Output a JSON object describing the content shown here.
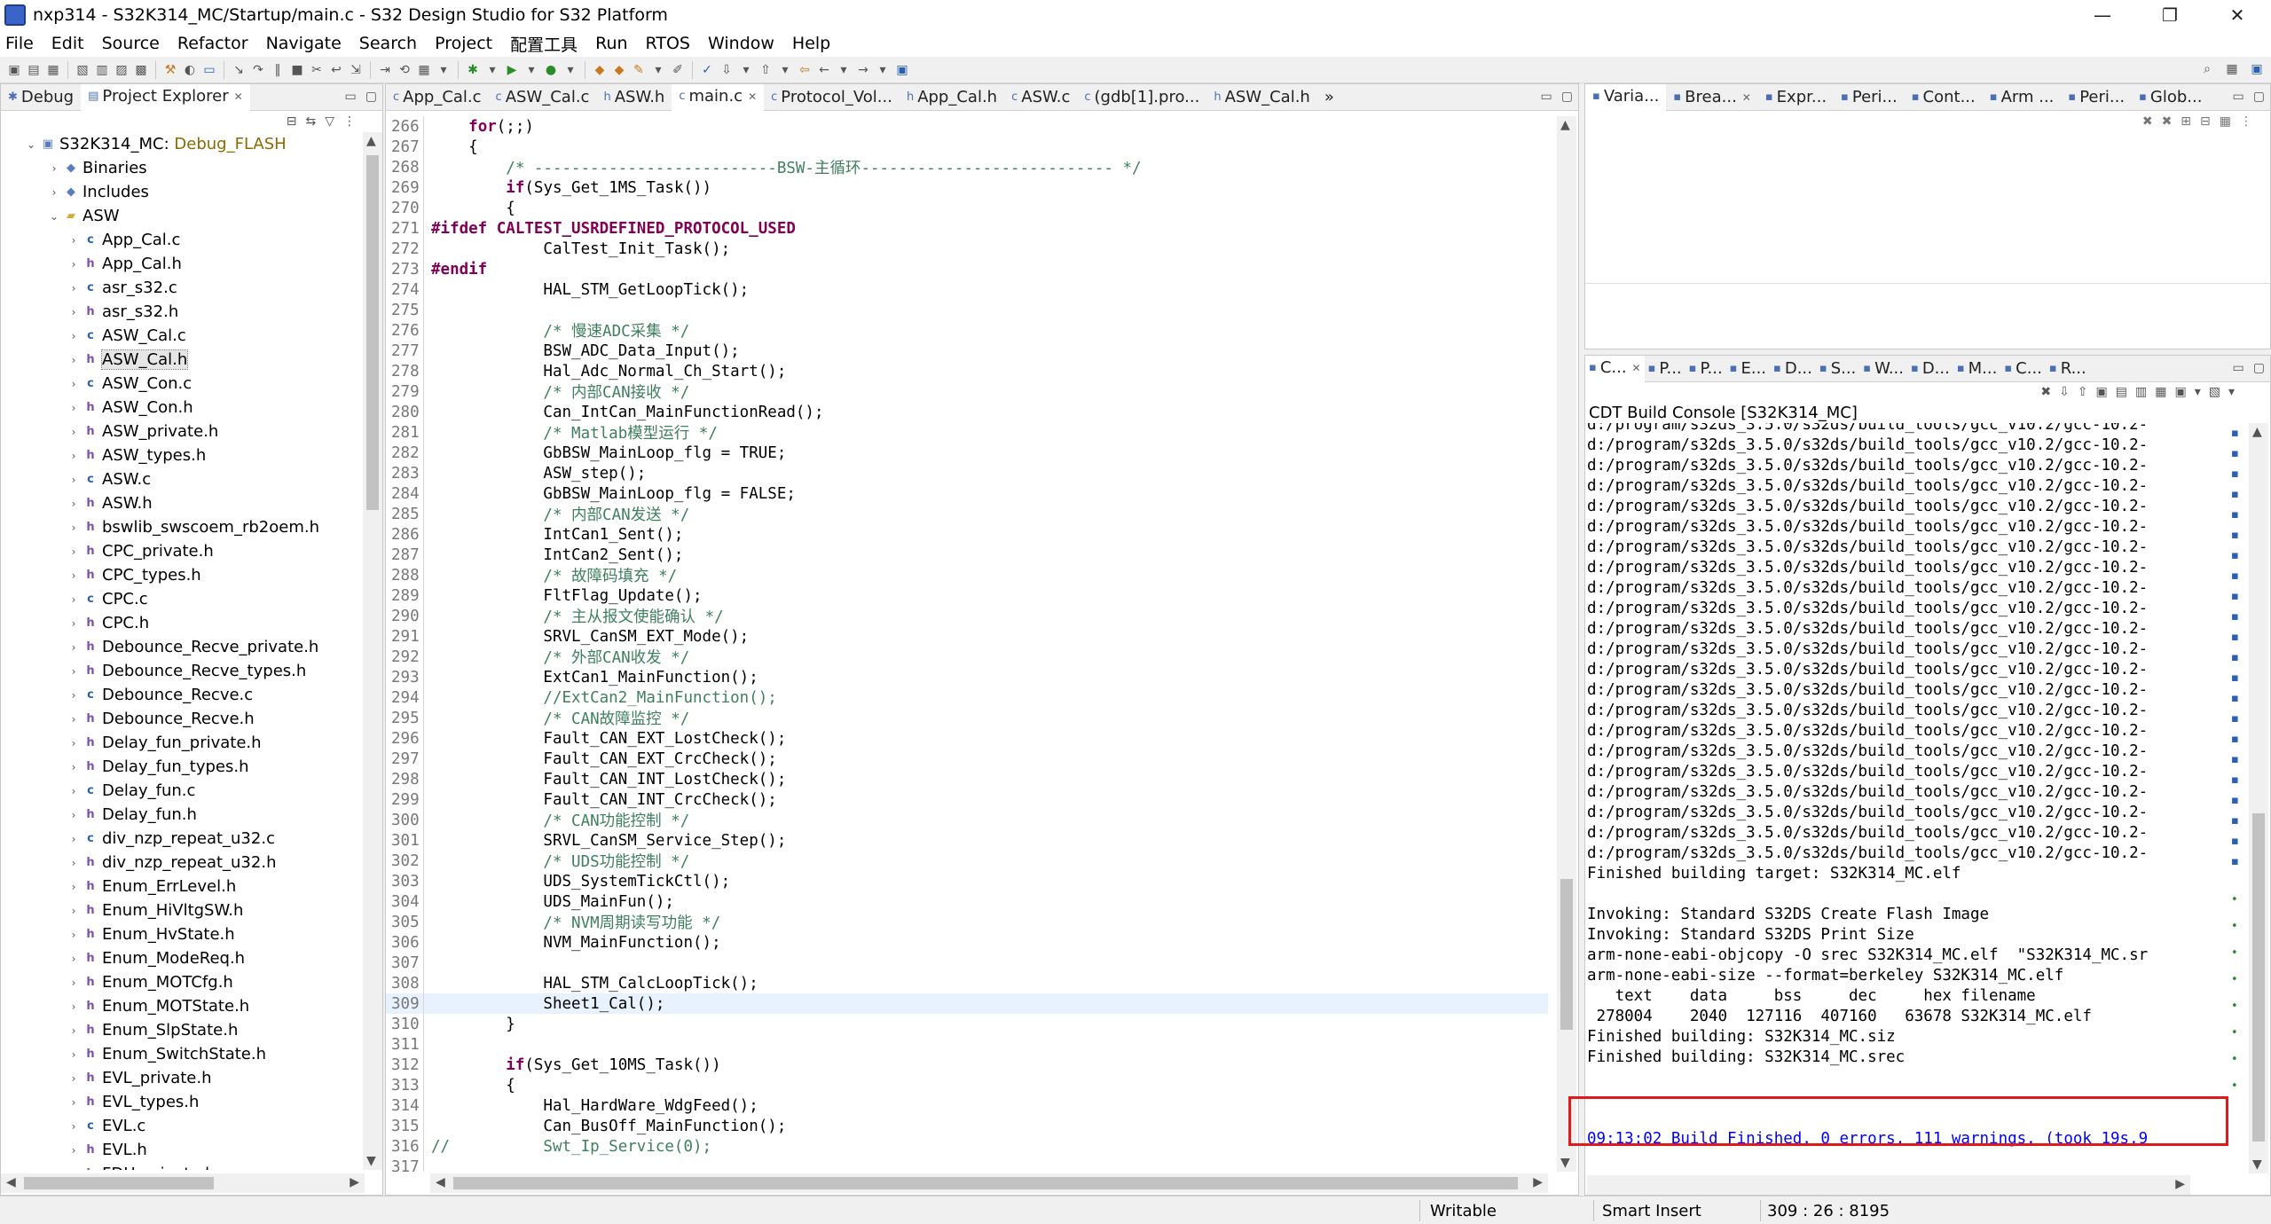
{
  "window": {
    "title": "nxp314 - S32K314_MC/Startup/main.c - S32 Design Studio for S32 Platform",
    "controls": [
      "—",
      "❐",
      "✕"
    ]
  },
  "menu": [
    "File",
    "Edit",
    "Source",
    "Refactor",
    "Navigate",
    "Search",
    "Project",
    "配置工具",
    "Run",
    "RTOS",
    "Window",
    "Help"
  ],
  "explorer": {
    "tabs": [
      {
        "icon": "debug-icon",
        "label": "Debug"
      },
      {
        "icon": "project-explorer-icon",
        "label": "Project Explorer"
      }
    ],
    "project": {
      "name": "S32K314_MC",
      "config": "Debug_FLASH"
    },
    "nodes": [
      {
        "label": "Binaries",
        "depth": 1,
        "expanded": false,
        "icon": "binaries-icon"
      },
      {
        "label": "Includes",
        "depth": 1,
        "expanded": false,
        "icon": "includes-icon"
      },
      {
        "label": "ASW",
        "depth": 1,
        "expanded": true,
        "icon": "folder-icon"
      }
    ],
    "files": [
      "App_Cal.c",
      "App_Cal.h",
      "asr_s32.c",
      "asr_s32.h",
      "ASW_Cal.c",
      "ASW_Cal.h",
      "ASW_Con.c",
      "ASW_Con.h",
      "ASW_private.h",
      "ASW_types.h",
      "ASW.c",
      "ASW.h",
      "bswlib_swscoem_rb2oem.h",
      "CPC_private.h",
      "CPC_types.h",
      "CPC.c",
      "CPC.h",
      "Debounce_Recve_private.h",
      "Debounce_Recve_types.h",
      "Debounce_Recve.c",
      "Debounce_Recve.h",
      "Delay_fun_private.h",
      "Delay_fun_types.h",
      "Delay_fun.c",
      "Delay_fun.h",
      "div_nzp_repeat_u32.c",
      "div_nzp_repeat_u32.h",
      "Enum_ErrLevel.h",
      "Enum_HiVltgSW.h",
      "Enum_HvState.h",
      "Enum_ModeReq.h",
      "Enum_MOTCfg.h",
      "Enum_MOTState.h",
      "Enum_SlpState.h",
      "Enum_SwitchState.h",
      "EVL_private.h",
      "EVL_types.h",
      "EVL.c",
      "EVL.h",
      "FDH_private.h"
    ],
    "selected": "ASW_Cal.h"
  },
  "editor": {
    "tabs": [
      "App_Cal.c",
      "ASW_Cal.c",
      "ASW.h",
      "main.c",
      "Protocol_Vol...",
      "App_Cal.h",
      "ASW.c",
      "(gdb[1].pro...",
      "ASW_Cal.h"
    ],
    "active_tab": "main.c",
    "overflow": "»",
    "current_line": 309,
    "lines": [
      {
        "n": "266",
        "t": "    for(;;)"
      },
      {
        "n": "267",
        "t": "    {"
      },
      {
        "n": "268",
        "t": "        /* --------------------------BSW-主循环--------------------------- */"
      },
      {
        "n": "269",
        "t": "        if(Sys_Get_1MS_Task())"
      },
      {
        "n": "270",
        "t": "        {"
      },
      {
        "n": "271",
        "t": "#ifdef CALTEST_USRDEFINED_PROTOCOL_USED"
      },
      {
        "n": "272",
        "t": "            CalTest_Init_Task();"
      },
      {
        "n": "273",
        "t": "#endif"
      },
      {
        "n": "274",
        "t": "            HAL_STM_GetLoopTick();"
      },
      {
        "n": "275",
        "t": ""
      },
      {
        "n": "276",
        "t": "            /* 慢速ADC采集 */"
      },
      {
        "n": "277",
        "t": "            BSW_ADC_Data_Input();"
      },
      {
        "n": "278",
        "t": "            Hal_Adc_Normal_Ch_Start();"
      },
      {
        "n": "279",
        "t": "            /* 内部CAN接收 */"
      },
      {
        "n": "280",
        "t": "            Can_IntCan_MainFunctionRead();"
      },
      {
        "n": "281",
        "t": "            /* Matlab模型运行 */"
      },
      {
        "n": "282",
        "t": "            GbBSW_MainLoop_flg = TRUE;"
      },
      {
        "n": "283",
        "t": "            ASW_step();"
      },
      {
        "n": "284",
        "t": "            GbBSW_MainLoop_flg = FALSE;"
      },
      {
        "n": "285",
        "t": "            /* 内部CAN发送 */"
      },
      {
        "n": "286",
        "t": "            IntCan1_Sent();"
      },
      {
        "n": "287",
        "t": "            IntCan2_Sent();"
      },
      {
        "n": "288",
        "t": "            /* 故障码填充 */"
      },
      {
        "n": "289",
        "t": "            FltFlag_Update();"
      },
      {
        "n": "290",
        "t": "            /* 主从报文使能确认 */"
      },
      {
        "n": "291",
        "t": "            SRVL_CanSM_EXT_Mode();"
      },
      {
        "n": "292",
        "t": "            /* 外部CAN收发 */"
      },
      {
        "n": "293",
        "t": "            ExtCan1_MainFunction();"
      },
      {
        "n": "294",
        "t": "            //ExtCan2_MainFunction();"
      },
      {
        "n": "295",
        "t": "            /* CAN故障监控 */"
      },
      {
        "n": "296",
        "t": "            Fault_CAN_EXT_LostCheck();"
      },
      {
        "n": "297",
        "t": "            Fault_CAN_EXT_CrcCheck();"
      },
      {
        "n": "298",
        "t": "            Fault_CAN_INT_LostCheck();"
      },
      {
        "n": "299",
        "t": "            Fault_CAN_INT_CrcCheck();"
      },
      {
        "n": "300",
        "t": "            /* CAN功能控制 */"
      },
      {
        "n": "301",
        "t": "            SRVL_CanSM_Service_Step();"
      },
      {
        "n": "302",
        "t": "            /* UDS功能控制 */"
      },
      {
        "n": "303",
        "t": "            UDS_SystemTickCtl();"
      },
      {
        "n": "304",
        "t": "            UDS_MainFun();"
      },
      {
        "n": "305",
        "t": "            /* NVM周期读写功能 */"
      },
      {
        "n": "306",
        "t": "            NVM_MainFunction();"
      },
      {
        "n": "307",
        "t": ""
      },
      {
        "n": "308",
        "t": "            HAL_STM_CalcLoopTick();"
      },
      {
        "n": "309",
        "t": "            Sheet1_Cal();"
      },
      {
        "n": "310",
        "t": "        }"
      },
      {
        "n": "311",
        "t": ""
      },
      {
        "n": "312",
        "t": "        if(Sys_Get_10MS_Task())"
      },
      {
        "n": "313",
        "t": "        {"
      },
      {
        "n": "314",
        "t": "            Hal_HardWare_WdgFeed();"
      },
      {
        "n": "315",
        "t": "            Can_BusOff_MainFunction();"
      },
      {
        "n": "316",
        "t": "//          Swt_Ip_Service(0);"
      },
      {
        "n": "317",
        "t": ""
      }
    ]
  },
  "top_right": {
    "tabs": [
      "Varia...",
      "Brea...",
      "Expr...",
      "Peri...",
      "Cont...",
      "Arm ...",
      "Peri...",
      "Glob..."
    ]
  },
  "console": {
    "tabs": [
      "C...",
      "P...",
      "P...",
      "E...",
      "D...",
      "S...",
      "W...",
      "D...",
      "M...",
      "C...",
      "R..."
    ],
    "title": "CDT Build Console [S32K314_MC]",
    "path_prefix": "d:/program/s32ds_3.5.0/s32ds/build_tools/gcc_v10.2/gcc-10.2-",
    "path_first": "d:/program/s32ds_3.5.0/s32ds/build_tools/gcc_v10.2/gcc-10.2-",
    "path_count": 22,
    "tail": [
      "Finished building target: S32K314_MC.elf",
      "",
      "Invoking: Standard S32DS Create Flash Image",
      "Invoking: Standard S32DS Print Size",
      "arm-none-eabi-objcopy -O srec S32K314_MC.elf  \"S32K314_MC.sr",
      "arm-none-eabi-size --format=berkeley S32K314_MC.elf",
      "   text    data     bss     dec     hex filename",
      " 278004    2040  127116  407160   63678 S32K314_MC.elf",
      "Finished building: S32K314_MC.siz",
      "Finished building: S32K314_MC.srec",
      "",
      "",
      "",
      "09:13:02 Build Finished. 0 errors, 111 warnings. (took 19s.9"
    ]
  },
  "status": {
    "mode": "Writable",
    "insert": "Smart Insert",
    "position": "309 : 26 : 8195"
  },
  "colors": {
    "keyword": "#7f0055",
    "comment": "#3f7f5f",
    "console_finish": "#0000ff",
    "highlight_box": "#e0191a",
    "current_line": "#e8f2fe"
  }
}
